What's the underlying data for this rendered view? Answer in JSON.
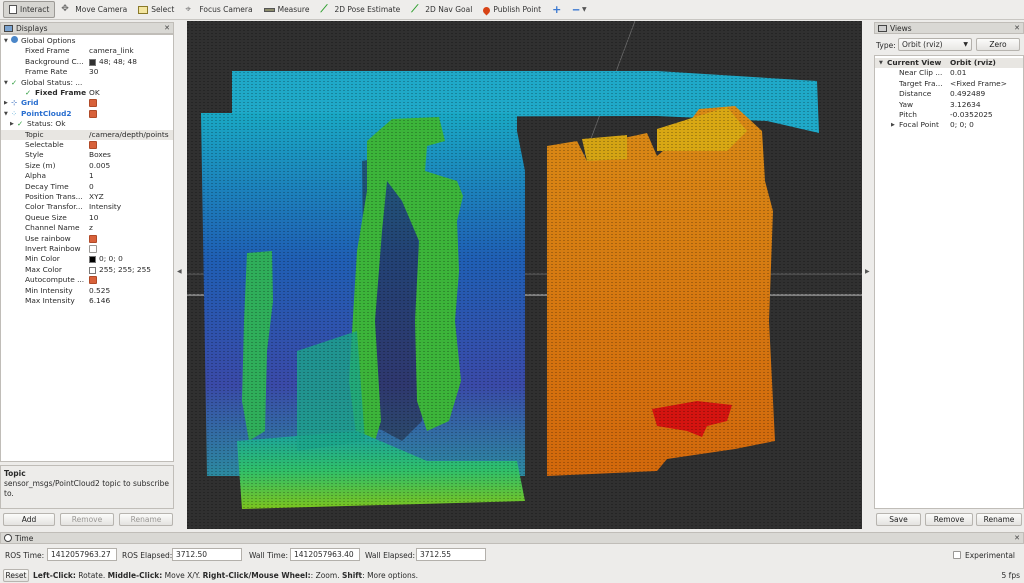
{
  "toolbar": {
    "items": [
      "Interact",
      "Move Camera",
      "Select",
      "Focus Camera",
      "Measure",
      "2D Pose Estimate",
      "2D Nav Goal",
      "Publish Point"
    ]
  },
  "displays": {
    "title": "Displays",
    "rows": [
      {
        "k": "Global Options",
        "v": ""
      },
      {
        "k": "Fixed Frame",
        "v": "camera_link"
      },
      {
        "k": "Background C...",
        "v": "48; 48; 48"
      },
      {
        "k": "Frame Rate",
        "v": "30"
      },
      {
        "k": "Global Status: ...",
        "v": ""
      },
      {
        "k": "Fixed Frame",
        "v": "OK"
      },
      {
        "k": "Grid",
        "v": ""
      },
      {
        "k": "PointCloud2",
        "v": ""
      },
      {
        "k": "Status: Ok",
        "v": ""
      },
      {
        "k": "Topic",
        "v": "/camera/depth/points"
      },
      {
        "k": "Selectable",
        "v": ""
      },
      {
        "k": "Style",
        "v": "Boxes"
      },
      {
        "k": "Size (m)",
        "v": "0.005"
      },
      {
        "k": "Alpha",
        "v": "1"
      },
      {
        "k": "Decay Time",
        "v": "0"
      },
      {
        "k": "Position Trans...",
        "v": "XYZ"
      },
      {
        "k": "Color Transfor...",
        "v": "Intensity"
      },
      {
        "k": "Queue Size",
        "v": "10"
      },
      {
        "k": "Channel Name",
        "v": "z"
      },
      {
        "k": "Use rainbow",
        "v": ""
      },
      {
        "k": "Invert Rainbow",
        "v": ""
      },
      {
        "k": "Min Color",
        "v": "0; 0; 0"
      },
      {
        "k": "Max Color",
        "v": "255; 255; 255"
      },
      {
        "k": "Autocompute ...",
        "v": ""
      },
      {
        "k": "Min Intensity",
        "v": "0.525"
      },
      {
        "k": "Max Intensity",
        "v": "6.146"
      }
    ],
    "help_title": "Topic",
    "help_text": "sensor_msgs/PointCloud2 topic to subscribe to.",
    "add": "Add",
    "remove": "Remove",
    "rename": "Rename"
  },
  "views": {
    "title": "Views",
    "type_label": "Type:",
    "type_value": "Orbit (rviz)",
    "zero": "Zero",
    "rows": [
      {
        "k": "Current View",
        "v": "Orbit (rviz)"
      },
      {
        "k": "Near Clip ...",
        "v": "0.01"
      },
      {
        "k": "Target Fra...",
        "v": "<Fixed Frame>"
      },
      {
        "k": "Distance",
        "v": "0.492489"
      },
      {
        "k": "Yaw",
        "v": "3.12634"
      },
      {
        "k": "Pitch",
        "v": "-0.0352025"
      },
      {
        "k": "Focal Point",
        "v": "0; 0; 0"
      }
    ],
    "save": "Save",
    "remove": "Remove",
    "rename": "Rename"
  },
  "time": {
    "title": "Time",
    "ros_time_label": "ROS Time:",
    "ros_time": "1412057963.27",
    "ros_elapsed_label": "ROS Elapsed:",
    "ros_elapsed": "3712.50",
    "wall_time_label": "Wall Time:",
    "wall_time": "1412057963.40",
    "wall_elapsed_label": "Wall Elapsed:",
    "wall_elapsed": "3712.55",
    "experimental": "Experimental"
  },
  "status": {
    "reset": "Reset",
    "b1": "Left-Click:",
    "t1": " Rotate. ",
    "b2": "Middle-Click:",
    "t2": " Move X/Y. ",
    "b3": "Right-Click/Mouse Wheel:",
    "t3": ": Zoom. ",
    "b4": "Shift",
    "t4": ": More options.",
    "fps": "5 fps"
  },
  "colors": {
    "background": "#303030",
    "checked": "#d8613a",
    "selected_row": "#e8e6e2"
  }
}
